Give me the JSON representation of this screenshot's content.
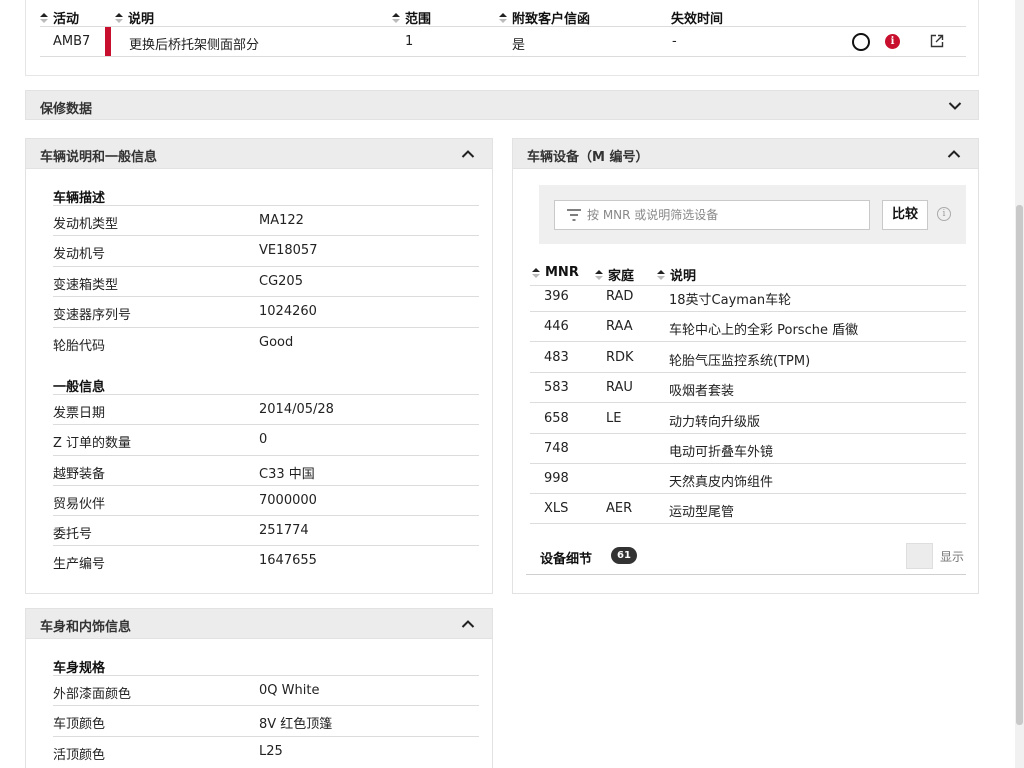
{
  "action_table": {
    "headers": {
      "activity": "活动",
      "description": "说明",
      "scope": "范围",
      "customer_letter": "附致客户信函",
      "expiry": "失效时间"
    },
    "row": {
      "activity": "AMB7",
      "description": "更换后桥托架侧面部分",
      "scope": "1",
      "customer_letter": "是",
      "expiry": "-"
    },
    "flag_color": "#c8102e",
    "info_icon_glyph": "i"
  },
  "warranty": {
    "title": "保修数据"
  },
  "vehicle_panel": {
    "title": "车辆说明和一般信息",
    "description_section": {
      "label": "车辆描述",
      "rows": [
        {
          "key": "发动机类型",
          "value": "MA122"
        },
        {
          "key": "发动机号",
          "value": "VE18057"
        },
        {
          "key": "变速箱类型",
          "value": "CG205"
        },
        {
          "key": "变速器序列号",
          "value": "1024260"
        },
        {
          "key": "轮胎代码",
          "value": "Good"
        }
      ]
    },
    "general_section": {
      "label": "一般信息",
      "rows": [
        {
          "key": "发票日期",
          "value": "2014/05/28"
        },
        {
          "key": "Z 订单的数量",
          "value": "0"
        },
        {
          "key": "越野装备",
          "value": "C33 中国"
        },
        {
          "key": "贸易伙伴",
          "value": "7000000"
        },
        {
          "key": "委托号",
          "value": "251774"
        },
        {
          "key": "生产编号",
          "value": "1647655"
        }
      ]
    }
  },
  "body_panel": {
    "title": "车身和内饰信息",
    "section_label": "车身规格",
    "rows": [
      {
        "key": "外部漆面颜色",
        "value": "0Q White"
      },
      {
        "key": "车顶颜色",
        "value": "8V 红色顶篷"
      },
      {
        "key": "活顶颜色",
        "value": "L25"
      }
    ]
  },
  "equipment_panel": {
    "title": "车辆设备（M 编号）",
    "filter_placeholder": "按 MNR 或说明筛选设备",
    "compare_label": "比较",
    "info_glyph": "i",
    "headers": {
      "mnr": "MNR",
      "family": "家庭",
      "description": "说明"
    },
    "rows": [
      {
        "mnr": "396",
        "family": "RAD",
        "description": "18英寸Cayman车轮"
      },
      {
        "mnr": "446",
        "family": "RAA",
        "description": "车轮中心上的全彩 Porsche 盾徽"
      },
      {
        "mnr": "483",
        "family": "RDK",
        "description": "轮胎气压监控系统(TPM)"
      },
      {
        "mnr": "583",
        "family": "RAU",
        "description": "吸烟者套装"
      },
      {
        "mnr": "658",
        "family": "LE",
        "description": "动力转向升级版"
      },
      {
        "mnr": "748",
        "family": "",
        "description": "电动可折叠车外镜"
      },
      {
        "mnr": "998",
        "family": "",
        "description": "天然真皮内饰组件"
      },
      {
        "mnr": "XLS",
        "family": "AER",
        "description": "运动型尾管"
      }
    ],
    "details_label": "设备细节",
    "details_count": "61",
    "show_label": "显示"
  }
}
